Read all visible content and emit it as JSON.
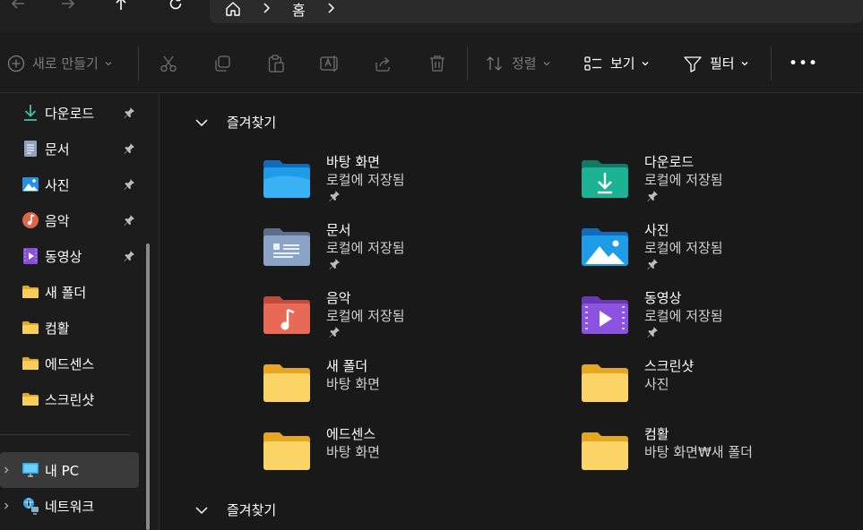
{
  "address_bar": {
    "breadcrumb": "홈"
  },
  "toolbar": {
    "new_label": "새로 만들기",
    "sort_label": "정렬",
    "view_label": "보기",
    "filter_label": "필터",
    "more_label": "•••"
  },
  "sidebar": {
    "items": [
      {
        "label": "다운로드",
        "icon": "download-icon",
        "pinned": true
      },
      {
        "label": "문서",
        "icon": "document-icon",
        "pinned": true
      },
      {
        "label": "사진",
        "icon": "pictures-icon",
        "pinned": true
      },
      {
        "label": "음악",
        "icon": "music-icon",
        "pinned": true
      },
      {
        "label": "동영상",
        "icon": "video-icon",
        "pinned": true
      },
      {
        "label": "새 폴더",
        "icon": "folder-icon",
        "pinned": false
      },
      {
        "label": "컴활",
        "icon": "folder-icon",
        "pinned": false
      },
      {
        "label": "에드센스",
        "icon": "folder-icon",
        "pinned": false
      },
      {
        "label": "스크린샷",
        "icon": "folder-icon",
        "pinned": false
      }
    ],
    "this_pc": "내 PC",
    "network": "네트워크"
  },
  "main": {
    "section_title": "즐겨찾기",
    "section_title_2": "즐겨찾기",
    "tiles": [
      {
        "name": "바탕 화면",
        "sub": "로컬에 저장됨",
        "icon": "desktop-folder-icon",
        "pinned": true
      },
      {
        "name": "다운로드",
        "sub": "로컬에 저장됨",
        "icon": "downloads-folder-icon",
        "pinned": true
      },
      {
        "name": "문서",
        "sub": "로컬에 저장됨",
        "icon": "documents-folder-icon",
        "pinned": true
      },
      {
        "name": "사진",
        "sub": "로컬에 저장됨",
        "icon": "pictures-folder-icon",
        "pinned": true
      },
      {
        "name": "음악",
        "sub": "로컬에 저장됨",
        "icon": "music-folder-icon",
        "pinned": true
      },
      {
        "name": "동영상",
        "sub": "로컬에 저장됨",
        "icon": "videos-folder-icon",
        "pinned": true
      },
      {
        "name": "새 폴더",
        "sub": "바탕 화면",
        "icon": "folder-icon",
        "pinned": false
      },
      {
        "name": "스크린샷",
        "sub": "사진",
        "icon": "folder-icon",
        "pinned": false
      },
      {
        "name": "에드센스",
        "sub": "바탕 화면",
        "icon": "folder-icon",
        "pinned": false
      },
      {
        "name": "컴활",
        "sub": "바탕 화면₩새 폴더",
        "icon": "folder-icon",
        "pinned": false
      }
    ]
  },
  "colors": {
    "background": "#191919",
    "accent_blue": "#1e90d6",
    "folder_yellow": "#f7c948"
  }
}
